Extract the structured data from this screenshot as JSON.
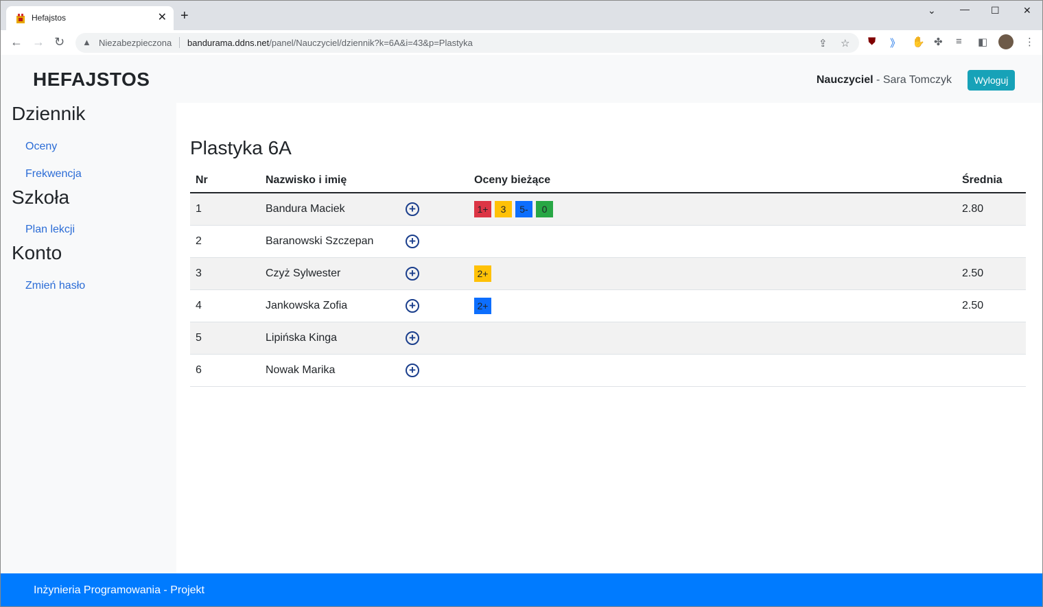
{
  "browser": {
    "tab_title": "Hefajstos",
    "insecure_label": "Niezabezpieczona",
    "url_domain": "bandurama.ddns.net",
    "url_path": "/panel/Nauczyciel/dziennik?k=6A&i=43&p=Plastyka"
  },
  "header": {
    "brand": "HEFAJSTOS",
    "role": "Nauczyciel",
    "user": " - Sara Tomczyk",
    "logout_label": "Wyloguj"
  },
  "sidebar": {
    "sections": [
      {
        "title": "Dziennik",
        "links": [
          "Oceny",
          "Frekwencja"
        ]
      },
      {
        "title": "Szkoła",
        "links": [
          "Plan lekcji"
        ]
      },
      {
        "title": "Konto",
        "links": [
          "Zmień hasło"
        ]
      }
    ]
  },
  "main": {
    "title": "Plastyka 6A",
    "columns": {
      "nr": "Nr",
      "name": "Nazwisko i imię",
      "grades": "Oceny bieżące",
      "avg": "Średnia"
    },
    "rows": [
      {
        "nr": "1",
        "name": "Bandura Maciek",
        "grades": [
          {
            "value": "1+",
            "color": "#dc3545"
          },
          {
            "value": "3",
            "color": "#ffc107"
          },
          {
            "value": "5-",
            "color": "#0d6efd"
          },
          {
            "value": "0",
            "color": "#28a745"
          }
        ],
        "avg": "2.80"
      },
      {
        "nr": "2",
        "name": "Baranowski Szczepan",
        "grades": [],
        "avg": ""
      },
      {
        "nr": "3",
        "name": "Czyż Sylwester",
        "grades": [
          {
            "value": "2+",
            "color": "#ffc107"
          }
        ],
        "avg": "2.50"
      },
      {
        "nr": "4",
        "name": "Jankowska Zofia",
        "grades": [
          {
            "value": "2+",
            "color": "#0d6efd"
          }
        ],
        "avg": "2.50"
      },
      {
        "nr": "5",
        "name": "Lipińska Kinga",
        "grades": [],
        "avg": ""
      },
      {
        "nr": "6",
        "name": "Nowak Marika",
        "grades": [],
        "avg": ""
      }
    ]
  },
  "footer": {
    "text": "Inżynieria Programowania - Projekt"
  }
}
